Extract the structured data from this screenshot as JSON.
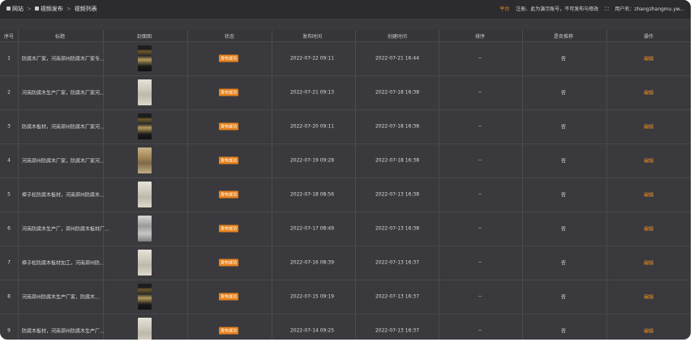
{
  "breadcrumb": [
    "网站",
    "视频发布",
    "视频列表"
  ],
  "header_right": {
    "link1": "平台",
    "link2": "注册、此为演示账号，不可发布与修改",
    "user": "用户名：zhangzhangmu.yw..."
  },
  "columns": [
    "序号",
    "标题",
    "封面图",
    "状态",
    "发布时间",
    "创建时间",
    "排序",
    "是否推荐",
    "操作"
  ],
  "rows": [
    {
      "idx": "1",
      "title": "防腐木厂家，河南郑州防腐木厂家专...",
      "status": "发布成功",
      "pub": "2022-07-22 09:11",
      "created": "2022-07-21 16:44",
      "sort": "--",
      "rec": "否",
      "op": "编辑",
      "thumb": "dark"
    },
    {
      "idx": "2",
      "title": "河南防腐木生产厂家，防腐木厂家河...",
      "status": "发布成功",
      "pub": "2022-07-21 09:13",
      "created": "2022-07-18 16:38",
      "sort": "--",
      "rec": "否",
      "op": "编辑",
      "thumb": "light"
    },
    {
      "idx": "3",
      "title": "防腐木板材，河南郑州防腐木厂家河...",
      "status": "发布成功",
      "pub": "2022-07-20 09:11",
      "created": "2022-07-18 16:38",
      "sort": "--",
      "rec": "否",
      "op": "编辑",
      "thumb": "dark"
    },
    {
      "idx": "4",
      "title": "河南郑州防腐木厂家，防腐木厂家河...",
      "status": "发布成功",
      "pub": "2022-07-19 09:28",
      "created": "2022-07-18 16:38",
      "sort": "--",
      "rec": "否",
      "op": "编辑",
      "thumb": "brown"
    },
    {
      "idx": "5",
      "title": "樟子松防腐木板材，河南郑州防腐木...",
      "status": "发布成功",
      "pub": "2022-07-18 08:56",
      "created": "2022-07-13 16:38",
      "sort": "--",
      "rec": "否",
      "op": "编辑",
      "thumb": "light"
    },
    {
      "idx": "6",
      "title": "河南防腐木生产厂，郑州防腐木板材厂...",
      "status": "发布成功",
      "pub": "2022-07-17 08:49",
      "created": "2022-07-13 16:38",
      "sort": "--",
      "rec": "否",
      "op": "编辑",
      "thumb": "gray"
    },
    {
      "idx": "7",
      "title": "樟子松防腐木板材加工，河南郑州防...",
      "status": "发布成功",
      "pub": "2022-07-16 08:39",
      "created": "2022-07-13 16:37",
      "sort": "--",
      "rec": "否",
      "op": "编辑",
      "thumb": "light"
    },
    {
      "idx": "8",
      "title": "河南郑州防腐木生产厂家，防腐木...",
      "status": "发布成功",
      "pub": "2022-07-15 09:19",
      "created": "2022-07-13 16:37",
      "sort": "--",
      "rec": "否",
      "op": "编辑",
      "thumb": "dark"
    },
    {
      "idx": "9",
      "title": "防腐木板材，河南郑州防腐木生产厂...",
      "status": "发布成功",
      "pub": "2022-07-14 09:25",
      "created": "2022-07-13 16:37",
      "sort": "--",
      "rec": "否",
      "op": "编辑",
      "thumb": "light"
    }
  ],
  "colors": {
    "accent": "#e8831c",
    "bg": "#3a3a3e",
    "header": "#2c2c30"
  }
}
